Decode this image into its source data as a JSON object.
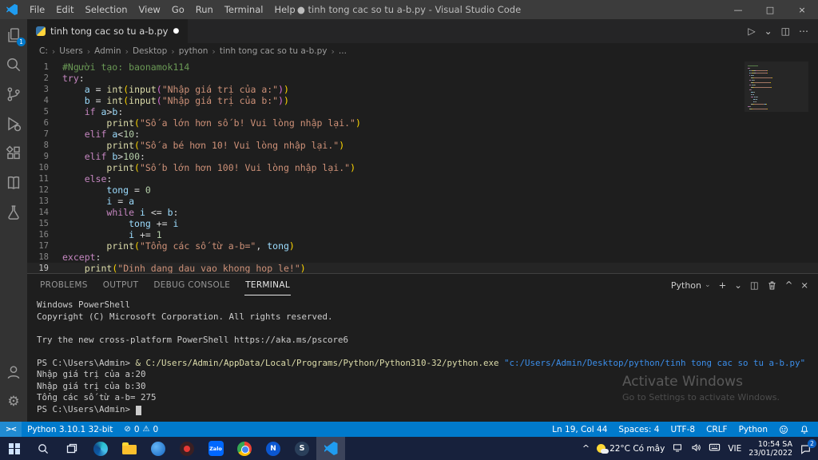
{
  "colors": {
    "accent": "#007acc",
    "titlebar-bg": "#3c3c3c",
    "activitybar-bg": "#333333",
    "tabbar-bg": "#252526",
    "editor-bg": "#1e1e1e",
    "statusbar-bg": "#007acc",
    "taskbar-bg": "#17213c",
    "tok-cmt": "#6a9955",
    "tok-kw": "#c586c0",
    "tok-fn": "#dcdcaa",
    "tok-str": "#ce9178",
    "tok-var": "#9cdcfe",
    "tok-num": "#b5cea8",
    "tok-pl": "#d4d4d4",
    "tok-b1": "#ffd700",
    "tok-b2": "#da70d6",
    "term-fg": "#cccccc",
    "term-path": "#dcdcaa",
    "term-str": "#3b8eea"
  },
  "icons": {
    "dirty": "●",
    "run": "▷",
    "caret": "⌄",
    "split": "◫",
    "more": "⋯",
    "plus": "+",
    "maximize": "^",
    "close": "×",
    "minimize": "—",
    "restore": "□",
    "problems_err": "⊘",
    "problems_warn": "⚠",
    "gear": "⚙",
    "tray_chevron": "^"
  },
  "title_bar": {
    "menus": [
      "File",
      "Edit",
      "Selection",
      "View",
      "Go",
      "Run",
      "Terminal",
      "Help"
    ],
    "title": "● tinh tong cac so tu a-b.py - Visual Studio Code"
  },
  "activity_bar": {
    "explorer_badge": "1"
  },
  "tab": {
    "label": "tinh tong cac so tu a-b.py"
  },
  "breadcrumb": {
    "items": [
      "C:",
      "Users",
      "Admin",
      "Desktop",
      "python",
      "tinh tong cac so tu a-b.py",
      "..."
    ]
  },
  "editor": {
    "active_line": 19,
    "lines": [
      [
        [
          "cmt",
          "#Người tạo: baonamok114"
        ]
      ],
      [
        [
          "kw",
          "try"
        ],
        [
          "pl",
          ":"
        ]
      ],
      [
        [
          "pl",
          "    "
        ],
        [
          "var",
          "a"
        ],
        [
          "pl",
          " = "
        ],
        [
          "fn",
          "int"
        ],
        [
          "b1",
          "("
        ],
        [
          "fn",
          "input"
        ],
        [
          "b2",
          "("
        ],
        [
          "str",
          "\"Nhập giá trị của a:\""
        ],
        [
          "b2",
          ")"
        ],
        [
          "b1",
          ")"
        ]
      ],
      [
        [
          "pl",
          "    "
        ],
        [
          "var",
          "b"
        ],
        [
          "pl",
          " = "
        ],
        [
          "fn",
          "int"
        ],
        [
          "b1",
          "("
        ],
        [
          "fn",
          "input"
        ],
        [
          "b2",
          "("
        ],
        [
          "str",
          "\"Nhập giá trị của b:\""
        ],
        [
          "b2",
          ")"
        ],
        [
          "b1",
          ")"
        ]
      ],
      [
        [
          "pl",
          "    "
        ],
        [
          "kw",
          "if"
        ],
        [
          "pl",
          " "
        ],
        [
          "var",
          "a"
        ],
        [
          "pl",
          ">"
        ],
        [
          "var",
          "b"
        ],
        [
          "pl",
          ":"
        ]
      ],
      [
        [
          "pl",
          "        "
        ],
        [
          "fn",
          "print"
        ],
        [
          "b1",
          "("
        ],
        [
          "str",
          "\"Số a lớn hơn số b! Vui lòng nhập lại.\""
        ],
        [
          "b1",
          ")"
        ]
      ],
      [
        [
          "pl",
          "    "
        ],
        [
          "kw",
          "elif"
        ],
        [
          "pl",
          " "
        ],
        [
          "var",
          "a"
        ],
        [
          "pl",
          "<"
        ],
        [
          "num",
          "10"
        ],
        [
          "pl",
          ":"
        ]
      ],
      [
        [
          "pl",
          "        "
        ],
        [
          "fn",
          "print"
        ],
        [
          "b1",
          "("
        ],
        [
          "str",
          "\"Số a bé hơn 10! Vui lòng nhập lại.\""
        ],
        [
          "b1",
          ")"
        ]
      ],
      [
        [
          "pl",
          "    "
        ],
        [
          "kw",
          "elif"
        ],
        [
          "pl",
          " "
        ],
        [
          "var",
          "b"
        ],
        [
          "pl",
          ">"
        ],
        [
          "num",
          "100"
        ],
        [
          "pl",
          ":"
        ]
      ],
      [
        [
          "pl",
          "        "
        ],
        [
          "fn",
          "print"
        ],
        [
          "b1",
          "("
        ],
        [
          "str",
          "\"Số b lớn hơn 100! Vui lòng nhập lại.\""
        ],
        [
          "b1",
          ")"
        ]
      ],
      [
        [
          "pl",
          "    "
        ],
        [
          "kw",
          "else"
        ],
        [
          "pl",
          ":"
        ]
      ],
      [
        [
          "pl",
          "        "
        ],
        [
          "var",
          "tong"
        ],
        [
          "pl",
          " = "
        ],
        [
          "num",
          "0"
        ]
      ],
      [
        [
          "pl",
          "        "
        ],
        [
          "var",
          "i"
        ],
        [
          "pl",
          " = "
        ],
        [
          "var",
          "a"
        ]
      ],
      [
        [
          "pl",
          "        "
        ],
        [
          "kw",
          "while"
        ],
        [
          "pl",
          " "
        ],
        [
          "var",
          "i"
        ],
        [
          "pl",
          " <= "
        ],
        [
          "var",
          "b"
        ],
        [
          "pl",
          ":"
        ]
      ],
      [
        [
          "pl",
          "            "
        ],
        [
          "var",
          "tong"
        ],
        [
          "pl",
          " += "
        ],
        [
          "var",
          "i"
        ]
      ],
      [
        [
          "pl",
          "            "
        ],
        [
          "var",
          "i"
        ],
        [
          "pl",
          " += "
        ],
        [
          "num",
          "1"
        ]
      ],
      [
        [
          "pl",
          "        "
        ],
        [
          "fn",
          "print"
        ],
        [
          "b1",
          "("
        ],
        [
          "str",
          "\"Tổng các số từ a-b=\""
        ],
        [
          "pl",
          ", "
        ],
        [
          "var",
          "tong"
        ],
        [
          "b1",
          ")"
        ]
      ],
      [
        [
          "kw",
          "except"
        ],
        [
          "pl",
          ":"
        ]
      ],
      [
        [
          "pl",
          "    "
        ],
        [
          "fn",
          "print"
        ],
        [
          "b1",
          "("
        ],
        [
          "str",
          "\"Dinh dang dau vao khong hop le!\""
        ],
        [
          "b1",
          ")"
        ]
      ]
    ]
  },
  "panel": {
    "tabs": [
      "PROBLEMS",
      "OUTPUT",
      "DEBUG CONSOLE",
      "TERMINAL"
    ],
    "active_tab": "TERMINAL",
    "shell_label": "Python",
    "terminal_lines": [
      [
        [
          "t",
          "Windows PowerShell"
        ]
      ],
      [
        [
          "t",
          "Copyright (C) Microsoft Corporation. All rights reserved."
        ]
      ],
      [],
      [
        [
          "t",
          "Try the new cross-platform PowerShell https://aka.ms/pscore6"
        ]
      ],
      [],
      [
        [
          "t",
          "PS C:\\Users\\Admin> "
        ],
        [
          "y",
          "& C:/Users/Admin/AppData/Local/Programs/Python/Python310-32/python.exe"
        ],
        [
          "b",
          " \"c:/Users/Admin/Desktop/python/tinh tong cac so tu a-b.py\""
        ]
      ],
      [
        [
          "t",
          "Nhập giá trị của a:20"
        ]
      ],
      [
        [
          "t",
          "Nhập giá trị của b:30"
        ]
      ],
      [
        [
          "t",
          "Tổng các số từ a-b= 275"
        ]
      ],
      [
        [
          "t",
          "PS C:\\Users\\Admin> "
        ],
        [
          "cur",
          " "
        ]
      ]
    ]
  },
  "watermark": {
    "line1": "Activate Windows",
    "line2": "Go to Settings to activate Windows."
  },
  "status_bar": {
    "remote": "><",
    "python_version": "Python 3.10.1 32-bit",
    "errors": "0",
    "warnings": "0",
    "cursor": "Ln 19, Col 44",
    "indent": "Spaces: 4",
    "encoding": "UTF-8",
    "eol": "CRLF",
    "language": "Python"
  },
  "taskbar": {
    "weather": "22°C Có mây",
    "language": "VIE",
    "time": "10:54 SA",
    "date": "23/01/2022",
    "notification_count": "2",
    "zalo_label": "Zalo",
    "coccoc_label": "N",
    "steam_label": "S"
  }
}
